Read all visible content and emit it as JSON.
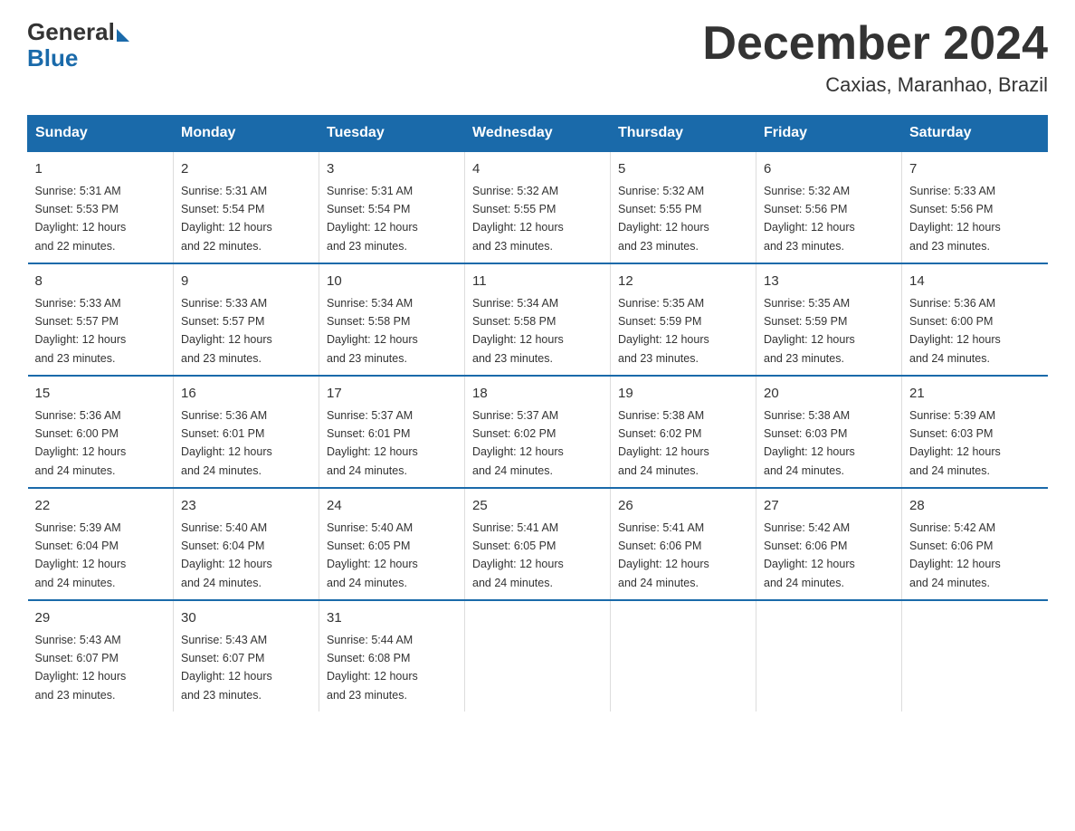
{
  "header": {
    "logo_general": "General",
    "logo_blue": "Blue",
    "month_title": "December 2024",
    "location": "Caxias, Maranhao, Brazil"
  },
  "days_of_week": [
    "Sunday",
    "Monday",
    "Tuesday",
    "Wednesday",
    "Thursday",
    "Friday",
    "Saturday"
  ],
  "weeks": [
    [
      {
        "num": "1",
        "sunrise": "5:31 AM",
        "sunset": "5:53 PM",
        "daylight": "12 hours and 22 minutes."
      },
      {
        "num": "2",
        "sunrise": "5:31 AM",
        "sunset": "5:54 PM",
        "daylight": "12 hours and 22 minutes."
      },
      {
        "num": "3",
        "sunrise": "5:31 AM",
        "sunset": "5:54 PM",
        "daylight": "12 hours and 23 minutes."
      },
      {
        "num": "4",
        "sunrise": "5:32 AM",
        "sunset": "5:55 PM",
        "daylight": "12 hours and 23 minutes."
      },
      {
        "num": "5",
        "sunrise": "5:32 AM",
        "sunset": "5:55 PM",
        "daylight": "12 hours and 23 minutes."
      },
      {
        "num": "6",
        "sunrise": "5:32 AM",
        "sunset": "5:56 PM",
        "daylight": "12 hours and 23 minutes."
      },
      {
        "num": "7",
        "sunrise": "5:33 AM",
        "sunset": "5:56 PM",
        "daylight": "12 hours and 23 minutes."
      }
    ],
    [
      {
        "num": "8",
        "sunrise": "5:33 AM",
        "sunset": "5:57 PM",
        "daylight": "12 hours and 23 minutes."
      },
      {
        "num": "9",
        "sunrise": "5:33 AM",
        "sunset": "5:57 PM",
        "daylight": "12 hours and 23 minutes."
      },
      {
        "num": "10",
        "sunrise": "5:34 AM",
        "sunset": "5:58 PM",
        "daylight": "12 hours and 23 minutes."
      },
      {
        "num": "11",
        "sunrise": "5:34 AM",
        "sunset": "5:58 PM",
        "daylight": "12 hours and 23 minutes."
      },
      {
        "num": "12",
        "sunrise": "5:35 AM",
        "sunset": "5:59 PM",
        "daylight": "12 hours and 23 minutes."
      },
      {
        "num": "13",
        "sunrise": "5:35 AM",
        "sunset": "5:59 PM",
        "daylight": "12 hours and 23 minutes."
      },
      {
        "num": "14",
        "sunrise": "5:36 AM",
        "sunset": "6:00 PM",
        "daylight": "12 hours and 24 minutes."
      }
    ],
    [
      {
        "num": "15",
        "sunrise": "5:36 AM",
        "sunset": "6:00 PM",
        "daylight": "12 hours and 24 minutes."
      },
      {
        "num": "16",
        "sunrise": "5:36 AM",
        "sunset": "6:01 PM",
        "daylight": "12 hours and 24 minutes."
      },
      {
        "num": "17",
        "sunrise": "5:37 AM",
        "sunset": "6:01 PM",
        "daylight": "12 hours and 24 minutes."
      },
      {
        "num": "18",
        "sunrise": "5:37 AM",
        "sunset": "6:02 PM",
        "daylight": "12 hours and 24 minutes."
      },
      {
        "num": "19",
        "sunrise": "5:38 AM",
        "sunset": "6:02 PM",
        "daylight": "12 hours and 24 minutes."
      },
      {
        "num": "20",
        "sunrise": "5:38 AM",
        "sunset": "6:03 PM",
        "daylight": "12 hours and 24 minutes."
      },
      {
        "num": "21",
        "sunrise": "5:39 AM",
        "sunset": "6:03 PM",
        "daylight": "12 hours and 24 minutes."
      }
    ],
    [
      {
        "num": "22",
        "sunrise": "5:39 AM",
        "sunset": "6:04 PM",
        "daylight": "12 hours and 24 minutes."
      },
      {
        "num": "23",
        "sunrise": "5:40 AM",
        "sunset": "6:04 PM",
        "daylight": "12 hours and 24 minutes."
      },
      {
        "num": "24",
        "sunrise": "5:40 AM",
        "sunset": "6:05 PM",
        "daylight": "12 hours and 24 minutes."
      },
      {
        "num": "25",
        "sunrise": "5:41 AM",
        "sunset": "6:05 PM",
        "daylight": "12 hours and 24 minutes."
      },
      {
        "num": "26",
        "sunrise": "5:41 AM",
        "sunset": "6:06 PM",
        "daylight": "12 hours and 24 minutes."
      },
      {
        "num": "27",
        "sunrise": "5:42 AM",
        "sunset": "6:06 PM",
        "daylight": "12 hours and 24 minutes."
      },
      {
        "num": "28",
        "sunrise": "5:42 AM",
        "sunset": "6:06 PM",
        "daylight": "12 hours and 24 minutes."
      }
    ],
    [
      {
        "num": "29",
        "sunrise": "5:43 AM",
        "sunset": "6:07 PM",
        "daylight": "12 hours and 23 minutes."
      },
      {
        "num": "30",
        "sunrise": "5:43 AM",
        "sunset": "6:07 PM",
        "daylight": "12 hours and 23 minutes."
      },
      {
        "num": "31",
        "sunrise": "5:44 AM",
        "sunset": "6:08 PM",
        "daylight": "12 hours and 23 minutes."
      },
      null,
      null,
      null,
      null
    ]
  ],
  "labels": {
    "sunrise": "Sunrise:",
    "sunset": "Sunset:",
    "daylight": "Daylight:"
  }
}
